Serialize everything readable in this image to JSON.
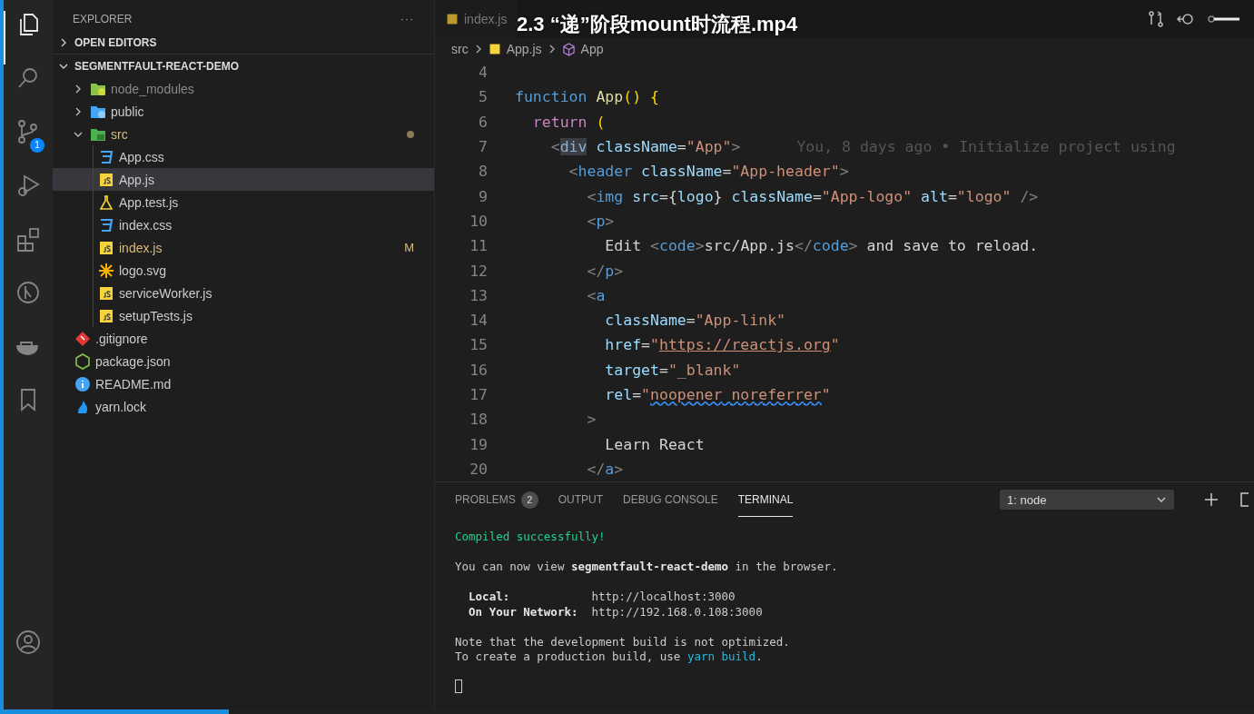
{
  "video_title": "2.3 “递”阶段mount时流程.mp4",
  "activity_bar": [
    {
      "kind": "files",
      "selected": true
    },
    {
      "kind": "search",
      "selected": false
    },
    {
      "kind": "source-control",
      "selected": false,
      "badge": "1"
    },
    {
      "kind": "run",
      "selected": false
    },
    {
      "kind": "extensions",
      "selected": false
    },
    {
      "kind": "git-graph",
      "selected": false
    },
    {
      "kind": "docker",
      "selected": false
    },
    {
      "kind": "bookmark",
      "selected": false
    }
  ],
  "account": {
    "kind": "account"
  },
  "sidebar": {
    "title": "EXPLORER",
    "more": "···",
    "sections": [
      {
        "label": "OPEN EDITORS",
        "expanded": false
      },
      {
        "label": "SEGMENTFAULT-REACT-DEMO",
        "expanded": true
      }
    ],
    "tree": [
      {
        "name": "node_modules",
        "kind": "folder-node",
        "expanded": false,
        "dimmed": true,
        "selected": false
      },
      {
        "name": "public",
        "kind": "folder-public",
        "expanded": false,
        "selected": false
      },
      {
        "name": "src",
        "kind": "folder-src",
        "expanded": true,
        "modified_dot": true,
        "selected": false,
        "children": [
          {
            "name": "App.css",
            "kind": "css",
            "selected": false
          },
          {
            "name": "App.js",
            "kind": "js",
            "selected": true
          },
          {
            "name": "App.test.js",
            "kind": "test",
            "selected": false
          },
          {
            "name": "index.css",
            "kind": "css",
            "selected": false
          },
          {
            "name": "index.js",
            "kind": "js",
            "selected": false,
            "decoration": "M"
          },
          {
            "name": "logo.svg",
            "kind": "svg",
            "selected": false
          },
          {
            "name": "serviceWorker.js",
            "kind": "js",
            "selected": false
          },
          {
            "name": "setupTests.js",
            "kind": "js",
            "selected": false
          }
        ]
      },
      {
        "name": ".gitignore",
        "kind": "git",
        "selected": false
      },
      {
        "name": "package.json",
        "kind": "json",
        "selected": false
      },
      {
        "name": "README.md",
        "kind": "info",
        "selected": false
      },
      {
        "name": "yarn.lock",
        "kind": "yarn",
        "selected": false
      }
    ]
  },
  "tabs": [
    {
      "label": "index.js",
      "selected": false
    }
  ],
  "breadcrumb": [
    {
      "label": "src",
      "kind": "folder"
    },
    {
      "label": "App.js",
      "kind": "js"
    },
    {
      "label": "App",
      "kind": "component"
    }
  ],
  "code": [
    {
      "n": "4"
    },
    {
      "n": "5",
      "segs": [
        {
          "t": "function ",
          "color": "#569cd6"
        },
        {
          "t": "App",
          "color": "#dcdcaa"
        },
        {
          "t": "() {",
          "color": "#ffd700"
        }
      ]
    },
    {
      "n": "6",
      "segs": [
        {
          "t": "  return ",
          "color": "#c586c0"
        },
        {
          "t": "(",
          "color": "#ffd700"
        }
      ]
    },
    {
      "n": "7",
      "segs": [
        {
          "t": "    <",
          "color": "#808080"
        },
        {
          "t": "div",
          "highlighted": true
        },
        {
          "t": " className",
          "color": "#9cdcfe"
        },
        {
          "t": "=",
          "color": "#d4d4d4"
        },
        {
          "t": "\"App\"",
          "color": "#ce9178"
        },
        {
          "t": ">",
          "color": "#808080"
        }
      ],
      "blame": "You, 8 days ago • Initialize project using"
    },
    {
      "n": "8",
      "segs": [
        {
          "t": "      <",
          "color": "#808080"
        },
        {
          "t": "header",
          "color": "#569cd6"
        },
        {
          "t": " className",
          "color": "#9cdcfe"
        },
        {
          "t": "=",
          "color": "#d4d4d4"
        },
        {
          "t": "\"App-header\"",
          "color": "#ce9178"
        },
        {
          "t": ">",
          "color": "#808080"
        }
      ]
    },
    {
      "n": "9",
      "segs": [
        {
          "t": "        <",
          "color": "#808080"
        },
        {
          "t": "img",
          "color": "#569cd6"
        },
        {
          "t": " src",
          "color": "#9cdcfe"
        },
        {
          "t": "={",
          "color": "#d4d4d4"
        },
        {
          "t": "logo",
          "color": "#9cdcfe"
        },
        {
          "t": "} ",
          "color": "#d4d4d4"
        },
        {
          "t": "className",
          "color": "#9cdcfe"
        },
        {
          "t": "=",
          "color": "#d4d4d4"
        },
        {
          "t": "\"App-logo\"",
          "color": "#ce9178"
        },
        {
          "t": " alt",
          "color": "#9cdcfe"
        },
        {
          "t": "=",
          "color": "#d4d4d4"
        },
        {
          "t": "\"logo\"",
          "color": "#ce9178"
        },
        {
          "t": " />",
          "color": "#808080"
        }
      ]
    },
    {
      "n": "10",
      "segs": [
        {
          "t": "        <",
          "color": "#808080"
        },
        {
          "t": "p",
          "color": "#569cd6"
        },
        {
          "t": ">",
          "color": "#808080"
        }
      ]
    },
    {
      "n": "11",
      "segs": [
        {
          "t": "          Edit ",
          "color": "#d4d4d4"
        },
        {
          "t": "<",
          "color": "#808080"
        },
        {
          "t": "code",
          "color": "#569cd6"
        },
        {
          "t": ">",
          "color": "#808080"
        },
        {
          "t": "src/App.js",
          "color": "#d4d4d4"
        },
        {
          "t": "</",
          "color": "#808080"
        },
        {
          "t": "code",
          "color": "#569cd6"
        },
        {
          "t": ">",
          "color": "#808080"
        },
        {
          "t": " and save to reload.",
          "color": "#d4d4d4"
        }
      ]
    },
    {
      "n": "12",
      "segs": [
        {
          "t": "        </",
          "color": "#808080"
        },
        {
          "t": "p",
          "color": "#569cd6"
        },
        {
          "t": ">",
          "color": "#808080"
        }
      ]
    },
    {
      "n": "13",
      "segs": [
        {
          "t": "        <",
          "color": "#808080"
        },
        {
          "t": "a",
          "color": "#569cd6"
        }
      ]
    },
    {
      "n": "14",
      "segs": [
        {
          "t": "          className",
          "color": "#9cdcfe"
        },
        {
          "t": "=",
          "color": "#d4d4d4"
        },
        {
          "t": "\"App-link\"",
          "color": "#ce9178"
        }
      ]
    },
    {
      "n": "15",
      "segs": [
        {
          "t": "          href",
          "color": "#9cdcfe"
        },
        {
          "t": "=",
          "color": "#d4d4d4"
        },
        {
          "t": "\"",
          "color": "#ce9178"
        },
        {
          "t": "https://reactjs.org",
          "color": "#ce9178",
          "underlined": true
        },
        {
          "t": "\"",
          "color": "#ce9178"
        }
      ]
    },
    {
      "n": "16",
      "segs": [
        {
          "t": "          target",
          "color": "#9cdcfe"
        },
        {
          "t": "=",
          "color": "#d4d4d4"
        },
        {
          "t": "\"_blank\"",
          "color": "#ce9178"
        }
      ]
    },
    {
      "n": "17",
      "segs": [
        {
          "t": "          rel",
          "color": "#9cdcfe"
        },
        {
          "t": "=",
          "color": "#d4d4d4"
        },
        {
          "t": "\"",
          "color": "#ce9178"
        },
        {
          "t": "noopener",
          "color": "#ce9178",
          "misspelled": true
        },
        {
          "t": " noreferrer",
          "color": "#ce9178",
          "misspelled": true
        },
        {
          "t": "\"",
          "color": "#ce9178"
        }
      ]
    },
    {
      "n": "18",
      "segs": [
        {
          "t": "        >",
          "color": "#808080"
        }
      ]
    },
    {
      "n": "19",
      "segs": [
        {
          "t": "          Learn React",
          "color": "#d4d4d4"
        }
      ]
    },
    {
      "n": "20",
      "segs": [
        {
          "t": "        </",
          "color": "#808080"
        },
        {
          "t": "a",
          "color": "#569cd6"
        },
        {
          "t": ">",
          "color": "#808080"
        }
      ]
    }
  ],
  "panel": {
    "tabs": [
      {
        "label": "PROBLEMS",
        "badge": "2",
        "selected": false
      },
      {
        "label": "OUTPUT",
        "selected": false
      },
      {
        "label": "DEBUG CONSOLE",
        "selected": false
      },
      {
        "label": "TERMINAL",
        "selected": true
      }
    ],
    "terminal_select": "1: node",
    "terminal": [
      {
        "gap_before": false,
        "segs": [
          {
            "t": "Compiled successfully!",
            "color": "#23d18b"
          }
        ]
      },
      {
        "gap_before": true,
        "segs": [
          {
            "t": "You can now view ",
            "color": "#cccccc"
          },
          {
            "t": "segmentfault-react-demo",
            "color": "#e5e5e5",
            "bold": true
          },
          {
            "t": " in the browser.",
            "color": "#cccccc"
          }
        ]
      },
      {
        "gap_before": true,
        "segs": [
          {
            "t": "  Local:            ",
            "color": "#e5e5e5",
            "bold": true
          },
          {
            "t": "http://localhost:3000",
            "color": "#cccccc"
          }
        ]
      },
      {
        "gap_before": false,
        "segs": [
          {
            "t": "  On Your Network:  ",
            "color": "#e5e5e5",
            "bold": true
          },
          {
            "t": "http://192.168.0.108:3000",
            "color": "#cccccc"
          }
        ]
      },
      {
        "gap_before": true,
        "segs": [
          {
            "t": "Note that the development build is not optimized.",
            "color": "#cccccc"
          }
        ]
      },
      {
        "gap_before": false,
        "segs": [
          {
            "t": "To create a production build, use ",
            "color": "#cccccc"
          },
          {
            "t": "yarn build",
            "color": "#29b8db"
          },
          {
            "t": "."
          }
        ]
      }
    ]
  },
  "video_progress": {
    "level": 0.18
  }
}
